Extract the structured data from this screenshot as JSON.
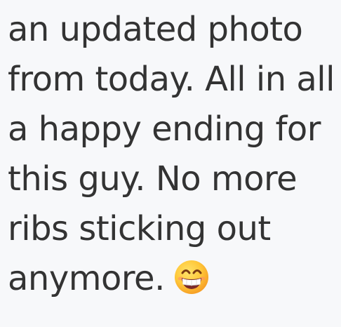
{
  "comment": {
    "lines": [
      "an updated photo",
      "from today. All in all",
      "a happy ending for",
      "this guy. No more",
      "ribs sticking out",
      "anymore."
    ],
    "emoji": "beaming-face-with-smiling-eyes"
  }
}
